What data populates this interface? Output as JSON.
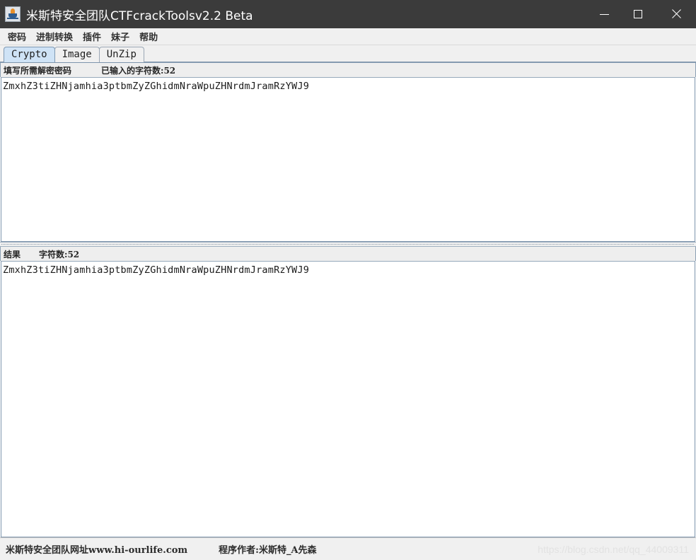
{
  "window": {
    "title": "米斯特安全团队CTFcrackToolsv2.2 Beta",
    "icon": "java-cup-icon",
    "controls": {
      "minimize": "minimize-icon",
      "maximize": "maximize-icon",
      "close": "close-icon"
    }
  },
  "menubar": {
    "items": [
      {
        "label": "密码"
      },
      {
        "label": "进制转换"
      },
      {
        "label": "插件"
      },
      {
        "label": "妹子"
      },
      {
        "label": "帮助"
      }
    ]
  },
  "tabs": [
    {
      "label": "Crypto",
      "active": true
    },
    {
      "label": "Image",
      "active": false
    },
    {
      "label": "UnZip",
      "active": false
    }
  ],
  "input_panel": {
    "label": "填写所需解密密码",
    "char_count_label": "已输入的字符数:52",
    "text": "ZmxhZ3tiZHNjamhia3ptbmZyZGhidmNraWpuZHNrdmJramRzYWJ9"
  },
  "result_panel": {
    "label": "结果",
    "char_count_label": "字符数:52",
    "text": "ZmxhZ3tiZHNjamhia3ptbmZyZGhidmNraWpuZHNrdmJramRzYWJ9"
  },
  "statusbar": {
    "website": "米斯特安全团队网址www.hi-ourlife.com",
    "author": "程序作者:米斯特_A先森",
    "watermark": "https://blog.csdn.net/qq_44009311"
  },
  "colors": {
    "titlebar_bg": "#3b3b3b",
    "titlebar_fg": "#ffffff",
    "panel_bg": "#f0f0f0",
    "label_bg": "#eeeeee",
    "active_tab_bg": "#cfe3f6",
    "border": "#7e95ad",
    "text": "#1b1b1b"
  }
}
